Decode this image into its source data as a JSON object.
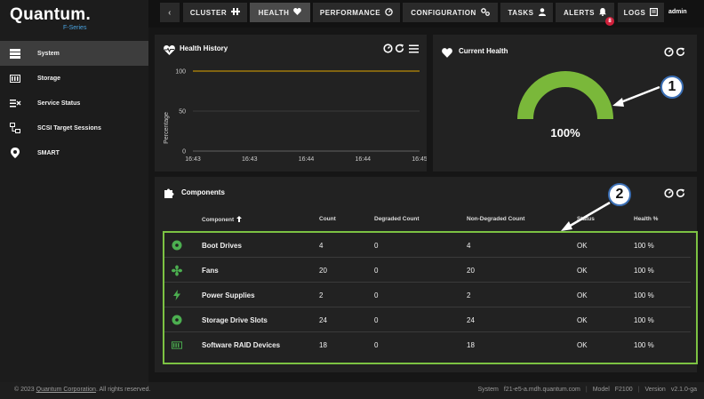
{
  "brand": {
    "name": "Quantum.",
    "subtitle": "F-Series"
  },
  "sidebar": {
    "items": [
      {
        "label": "System",
        "icon": "server-icon"
      },
      {
        "label": "Storage",
        "icon": "storage-icon"
      },
      {
        "label": "Service Status",
        "icon": "service-status-icon"
      },
      {
        "label": "SCSI Target Sessions",
        "icon": "scsi-icon"
      },
      {
        "label": "SMART",
        "icon": "smart-icon"
      }
    ]
  },
  "topnav": {
    "back": "‹",
    "tabs": [
      {
        "label": "CLUSTER",
        "icon": "cluster-icon"
      },
      {
        "label": "HEALTH",
        "icon": "heart-icon"
      },
      {
        "label": "PERFORMANCE",
        "icon": "gauge-icon"
      },
      {
        "label": "CONFIGURATION",
        "icon": "config-icon"
      },
      {
        "label": "TASKS",
        "icon": "user-icon"
      },
      {
        "label": "ALERTS",
        "icon": "bell-icon"
      },
      {
        "label": "LOGS",
        "icon": "logs-icon"
      }
    ],
    "alerts_count": "8",
    "user": "admin"
  },
  "health_history": {
    "title": "Health History",
    "chart_data": {
      "type": "line",
      "x": [
        "16:43",
        "16:43",
        "16:44",
        "16:44",
        "16:45"
      ],
      "series": [
        {
          "values": [
            100,
            100,
            100,
            100,
            100
          ]
        }
      ],
      "ylabel": "Percentage",
      "yticks": [
        "100",
        "50",
        "0"
      ],
      "ylim": [
        0,
        100
      ],
      "line_color": "#e0a500"
    }
  },
  "current_health": {
    "title": "Current Health",
    "value_text": "100%",
    "value": 100,
    "gauge_color": "#7ab83a"
  },
  "components": {
    "title": "Components",
    "columns": [
      "Component",
      "Count",
      "Degraded Count",
      "Non-Degraded Count",
      "Status",
      "Health %"
    ],
    "rows": [
      {
        "icon": "disk-icon",
        "name": "Boot Drives",
        "count": "4",
        "degraded": "0",
        "non_degraded": "4",
        "status": "OK",
        "health": "100 %"
      },
      {
        "icon": "fan-icon",
        "name": "Fans",
        "count": "20",
        "degraded": "0",
        "non_degraded": "20",
        "status": "OK",
        "health": "100 %"
      },
      {
        "icon": "power-icon",
        "name": "Power Supplies",
        "count": "2",
        "degraded": "0",
        "non_degraded": "2",
        "status": "OK",
        "health": "100 %"
      },
      {
        "icon": "disk-icon",
        "name": "Storage Drive Slots",
        "count": "24",
        "degraded": "0",
        "non_degraded": "24",
        "status": "OK",
        "health": "100 %"
      },
      {
        "icon": "raid-icon",
        "name": "Software RAID Devices",
        "count": "18",
        "degraded": "0",
        "non_degraded": "18",
        "status": "OK",
        "health": "100 %"
      }
    ]
  },
  "callouts": [
    "1",
    "2"
  ],
  "footer": {
    "copyright_prefix": "© 2023",
    "company": "Quantum Corporation",
    "copyright_suffix": ". All rights reserved.",
    "system_label": "System",
    "system_value": "f21-e5-a.mdh.quantum.com",
    "model_label": "Model",
    "model_value": "F2100",
    "version_label": "Version",
    "version_value": "v2.1.0-ga"
  }
}
